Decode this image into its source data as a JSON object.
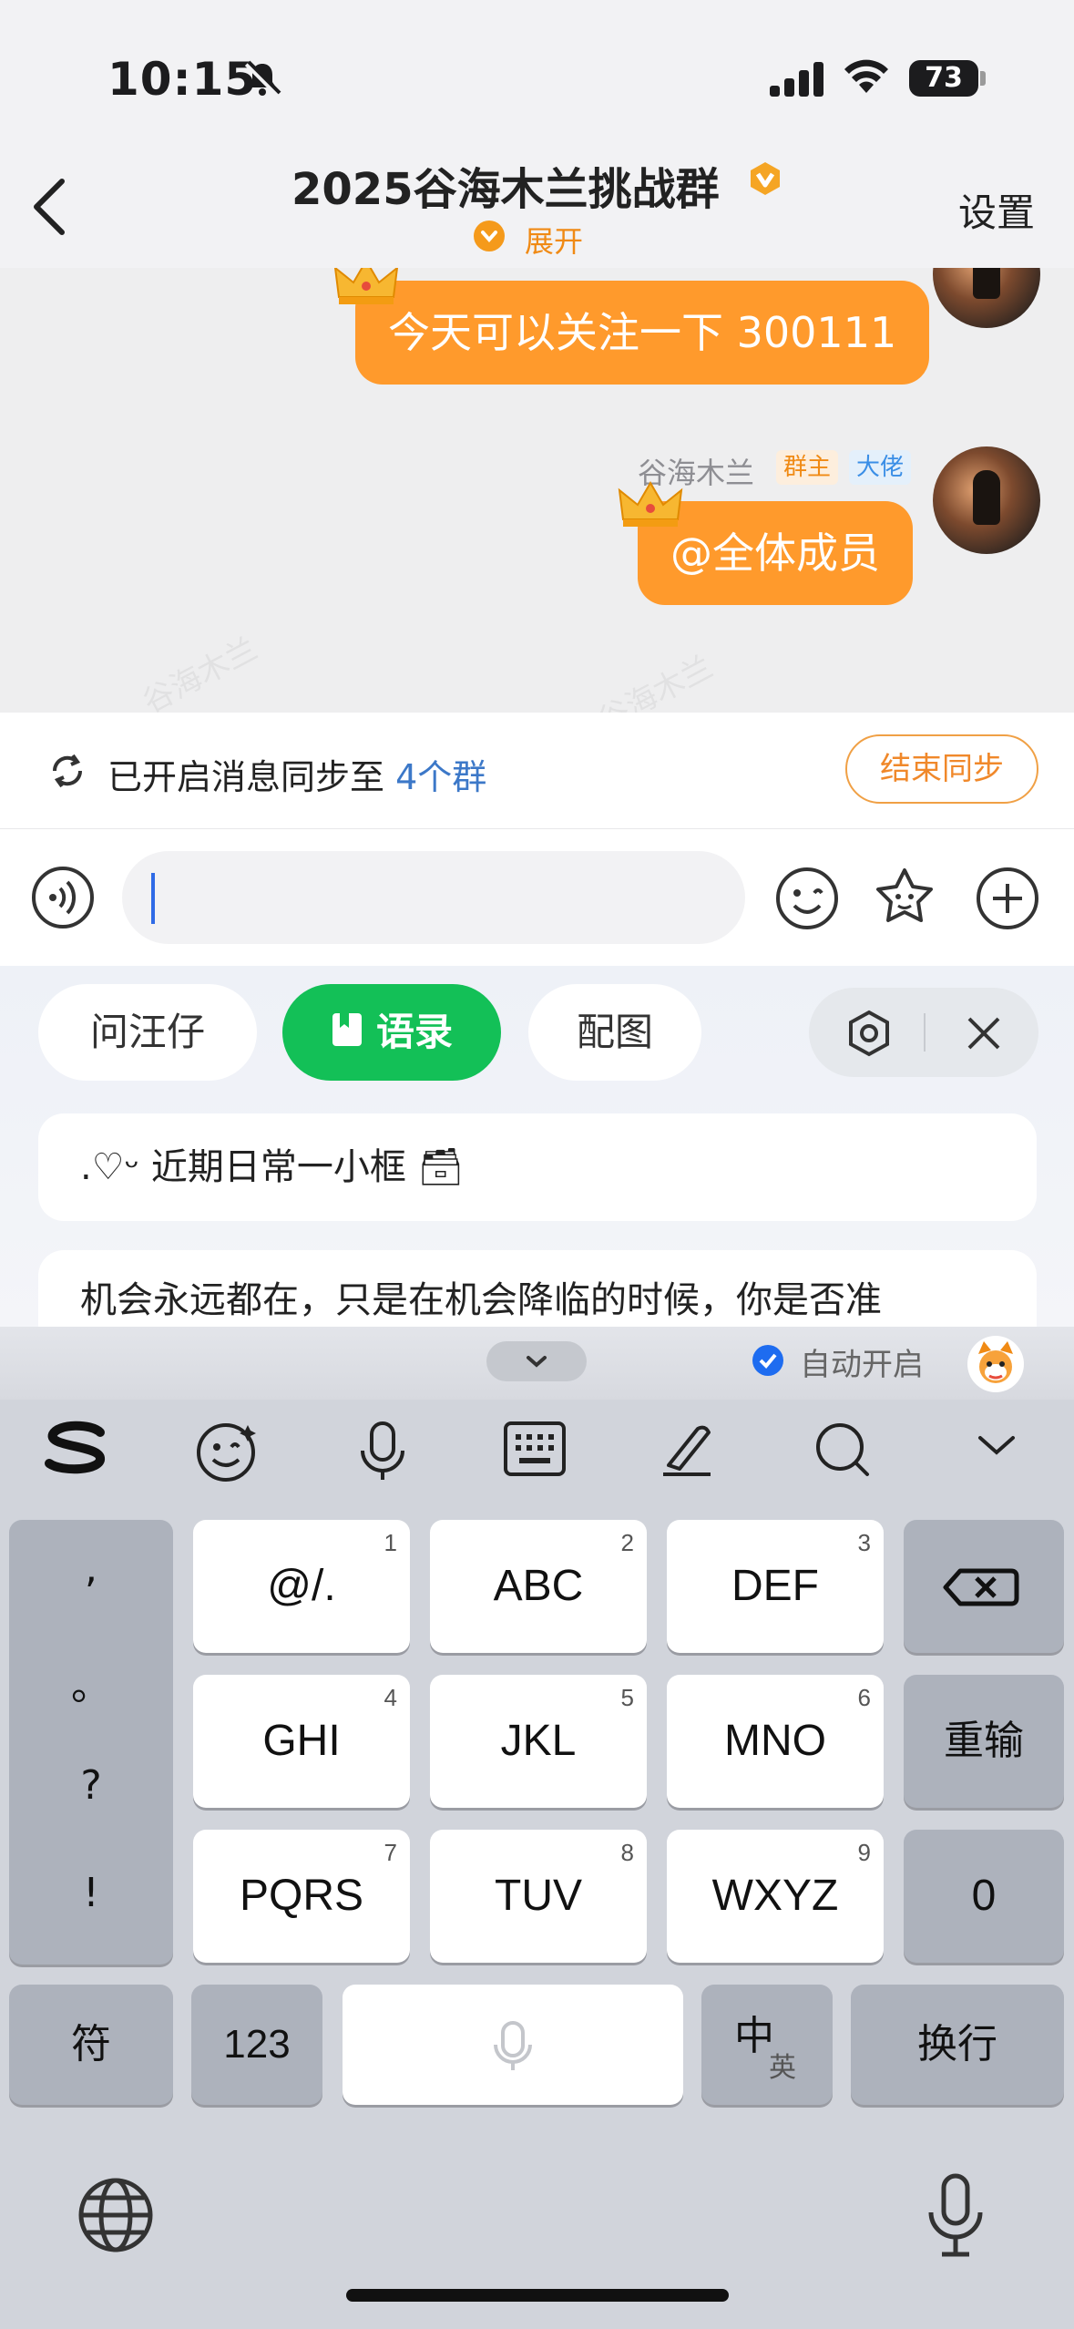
{
  "status_bar": {
    "time": "10:15",
    "battery": "73"
  },
  "nav": {
    "title": "2025谷海木兰挑战群",
    "expand": "展开",
    "settings": "设置"
  },
  "chat": {
    "watermark": "谷海木兰",
    "messages": [
      {
        "text": "今天可以关注一下 300111"
      },
      {
        "sender": "谷海木兰",
        "tags": [
          "群主",
          "大佬"
        ],
        "text": "@全体成员"
      }
    ]
  },
  "sync": {
    "prefix": "已开启消息同步至",
    "count": "4个群",
    "end_button": "结束同步"
  },
  "input": {
    "value": ""
  },
  "panel": {
    "chips": [
      "问汪仔",
      "语录",
      "配图"
    ],
    "cards": [
      ".♡ᵕ 近期日常一小框 🗃",
      "机会永远都在，只是在机会降临的时候，你是否准"
    ]
  },
  "keyboard": {
    "auto_open": "自动开启",
    "punct": [
      ",",
      "。",
      "?",
      "!"
    ],
    "rows": [
      [
        {
          "num": "1",
          "label": "@/."
        },
        {
          "num": "2",
          "label": "ABC"
        },
        {
          "num": "3",
          "label": "DEF"
        }
      ],
      [
        {
          "num": "4",
          "label": "GHI"
        },
        {
          "num": "5",
          "label": "JKL"
        },
        {
          "num": "6",
          "label": "MNO"
        }
      ],
      [
        {
          "num": "7",
          "label": "PQRS"
        },
        {
          "num": "8",
          "label": "TUV"
        },
        {
          "num": "9",
          "label": "WXYZ"
        }
      ]
    ],
    "reinput": "重输",
    "zero": "0",
    "symbols": "符",
    "numbers": "123",
    "zh": "中",
    "en": "英",
    "enter": "换行"
  },
  "colors": {
    "accent": "#ff9a2c",
    "green": "#13c057",
    "link": "#3c78c8"
  }
}
